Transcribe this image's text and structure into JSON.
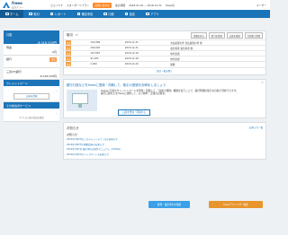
{
  "topbar": {
    "logo_text": "freee",
    "logo_sub": "会計フリー",
    "items": [
      "エコノミナ",
      "スタンダードプラン",
      "お問い合わせ",
      "会計期間",
      "2018-01-01 ~ 2018-12-31",
      "freeeの"
    ],
    "highlight_badge": "お問い合わせ",
    "user_label": "ユーザー"
  },
  "nav": {
    "items": [
      "ホーム",
      "取引",
      "レポート",
      "確定申告",
      "口座",
      "設定",
      "アプリ"
    ]
  },
  "sidebar": {
    "header_label": "口座",
    "header_amount": "-8,318,528円",
    "sections": [
      {
        "label": "現金",
        "value": "0円"
      },
      {
        "label": "銀行",
        "tag": "追加",
        "value": "-"
      },
      {
        "label": "三菱UFJ銀行",
        "value": "-8,318,528円"
      },
      {
        "label": "クレジットカード",
        "value": "-"
      },
      {
        "label": "その他決済サービス",
        "value": "-"
      }
    ],
    "add_button": "口座を登録",
    "note": "すべての口座の残高を確認"
  },
  "transactions": {
    "title": "取引",
    "count": "15",
    "tools": [
      "詳細を見る",
      "取引を登録",
      "口座を登録",
      "仕訳帳で登録"
    ],
    "rows": [
      {
        "tag": "支出",
        "amount": "102,989",
        "date": "2018-12-31",
        "desc": "支払処理の件 支払処理の件 他"
      },
      {
        "tag": "支出",
        "amount": "299,940",
        "date": "2018-12-31",
        "desc": "電気料金 電気料金 他"
      },
      {
        "tag": "支出",
        "amount": "107,887",
        "date": "2018-12-18",
        "desc": "地代家賃"
      },
      {
        "tag": "支出",
        "amount": "94,185",
        "date": "2018-12-18",
        "desc": "地代家賃"
      },
      {
        "tag": "支出",
        "amount": "2,000",
        "date": "2018-12-20",
        "desc": "雑費"
      }
    ],
    "more_link": "取引一覧を開く"
  },
  "promo": {
    "title": "銀行口座などをfreeeに登録・同期して、取引の登録を効率化しましょう",
    "body": "freeeに口座やクレジットカードを登録・同期して、「自動で経理」機能を使うことで、銀行明細の取引を自動で登録できます。",
    "body2": "銀行口座などをfreeeと連携して、より簡単・正確な記帳を。",
    "button": "口座を登録・同期する"
  },
  "news": {
    "title": "お知らせ",
    "all_link": "お知らせ一覧",
    "subtitle": "お知らせ",
    "items": [
      "2019年3月27日 システムメンテナンスのお知らせ",
      "2019年3月27日 機能改善のお知らせ",
      "2019年3月7日 確定申告の操作マニュアル（2019年）",
      "2019年2月27日 アップデートのお知らせ"
    ]
  },
  "floats": {
    "left": "経理・確定申告を相談",
    "right": "freeeアドバイザー検索"
  }
}
